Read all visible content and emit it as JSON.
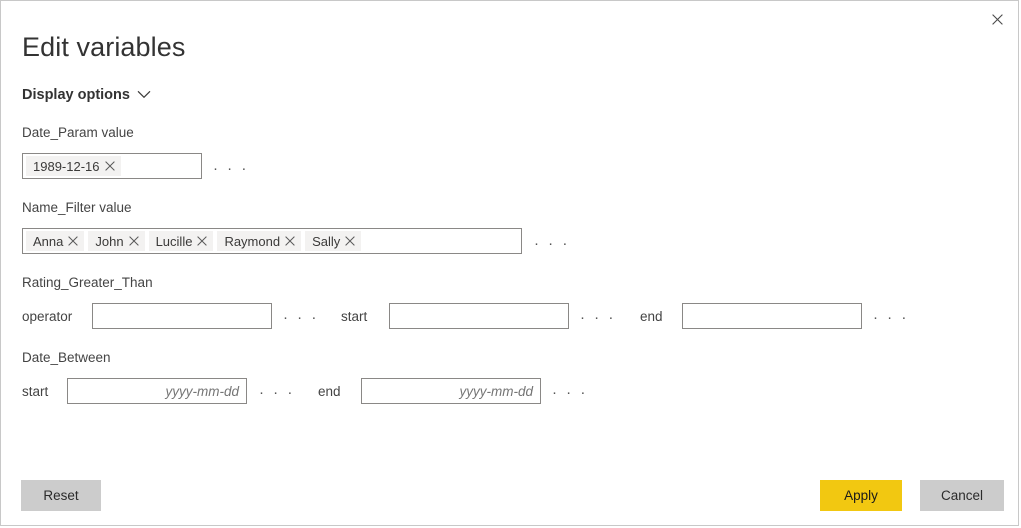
{
  "window": {
    "title": "Edit variables",
    "close_icon": "close-icon"
  },
  "display_options": {
    "label": "Display options",
    "chevron_icon": "chevron-down-icon",
    "expanded": false
  },
  "ellipsis_label": "· · ·",
  "sections": [
    {
      "name": "date_param",
      "label": "Date_Param value",
      "type": "tag-input",
      "tags": [
        {
          "label": "1989-12-16",
          "remove_icon": "close-icon"
        }
      ],
      "ellipsis": "more-options"
    },
    {
      "name": "name_filter",
      "label": "Name_Filter value",
      "type": "tag-input",
      "tags": [
        {
          "label": "Anna",
          "remove_icon": "close-icon"
        },
        {
          "label": "John",
          "remove_icon": "close-icon"
        },
        {
          "label": "Lucille",
          "remove_icon": "close-icon"
        },
        {
          "label": "Raymond",
          "remove_icon": "close-icon"
        },
        {
          "label": "Sally",
          "remove_icon": "close-icon"
        }
      ],
      "ellipsis": "more-options"
    },
    {
      "name": "rating_greater_than",
      "label": "Rating_Greater_Than",
      "type": "triple-field",
      "fields": [
        {
          "name": "operator",
          "label": "operator",
          "value": "",
          "placeholder": ""
        },
        {
          "name": "start",
          "label": "start",
          "value": "",
          "placeholder": ""
        },
        {
          "name": "end",
          "label": "end",
          "value": "",
          "placeholder": ""
        }
      ]
    },
    {
      "name": "date_between",
      "label": "Date_Between",
      "type": "double-field",
      "fields": [
        {
          "name": "start",
          "label": "start",
          "value": "",
          "placeholder": "yyyy-mm-dd"
        },
        {
          "name": "end",
          "label": "end",
          "value": "",
          "placeholder": "yyyy-mm-dd"
        }
      ]
    }
  ],
  "footer": {
    "reset_label": "Reset",
    "apply_label": "Apply",
    "cancel_label": "Cancel"
  },
  "colors": {
    "apply_background": "#f2c811",
    "neutral_button_background": "#cccccc",
    "tag_background": "#f3f2f1",
    "input_border": "#8a8886",
    "window_border": "#c8c8c8",
    "text": "#333333"
  }
}
